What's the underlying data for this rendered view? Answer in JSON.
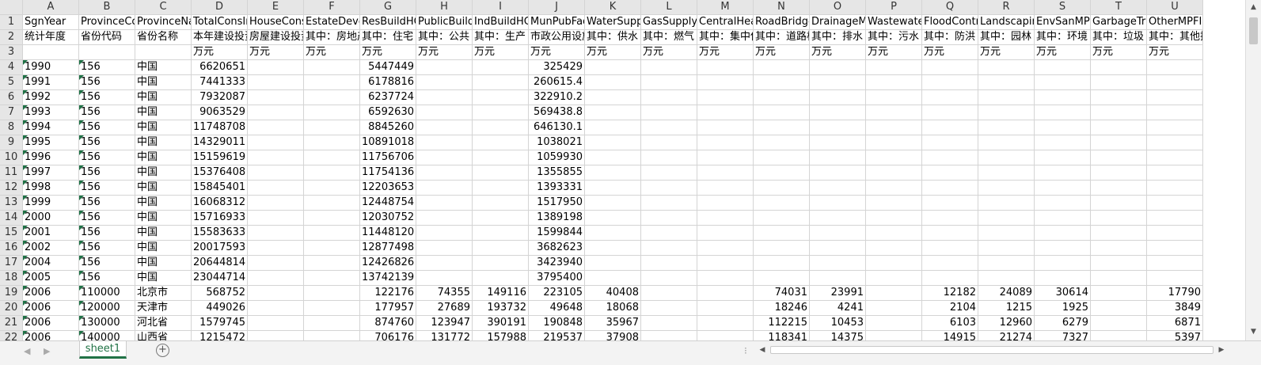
{
  "sheet": {
    "columns": [
      "A",
      "B",
      "C",
      "D",
      "E",
      "F",
      "G",
      "H",
      "I",
      "J",
      "K",
      "L",
      "M",
      "N",
      "O",
      "P",
      "Q",
      "R",
      "S",
      "T",
      "U"
    ],
    "rows": [
      [
        "SgnYear",
        "ProvinceCode",
        "ProvinceName",
        "TotalConsInv",
        "HouseConsInv",
        "EstateDevelop",
        "ResBuildHC",
        "PublicBuildHC",
        "IndBuildHC",
        "MunPubFac",
        "WaterSupply",
        "GasSupply",
        "CentralHeating",
        "RoadBridge",
        "DrainageM",
        "Wastewater",
        "FloodControl",
        "Landscaping",
        "EnvSanMP",
        "GarbageTr",
        "OtherMPFI"
      ],
      [
        "统计年度",
        "省份代码",
        "省份名称",
        "本年建设投资",
        "房屋建设投资",
        "其中：房地产",
        "其中：住宅",
        "其中：公共",
        "其中：生产",
        "市政公用设施",
        "其中：供水",
        "其中：燃气",
        "其中：集中供热",
        "其中：道路桥梁",
        "其中：排水",
        "其中：污水",
        "其中：防洪",
        "其中：园林",
        "其中：环境",
        "其中：垃圾",
        "其中：其他投入"
      ],
      [
        "",
        "",
        "",
        "万元",
        "万元",
        "万元",
        "万元",
        "万元",
        "万元",
        "万元",
        "万元",
        "万元",
        "万元",
        "万元",
        "万元",
        "万元",
        "万元",
        "万元",
        "万元",
        "万元",
        "万元"
      ],
      [
        "1990",
        "156",
        "中国",
        "6620651",
        "",
        "",
        "5447449",
        "",
        "",
        "325429",
        "",
        "",
        "",
        "",
        "",
        "",
        "",
        "",
        "",
        "",
        ""
      ],
      [
        "1991",
        "156",
        "中国",
        "7441333",
        "",
        "",
        "6178816",
        "",
        "",
        "260615.4",
        "",
        "",
        "",
        "",
        "",
        "",
        "",
        "",
        "",
        "",
        ""
      ],
      [
        "1992",
        "156",
        "中国",
        "7932087",
        "",
        "",
        "6237724",
        "",
        "",
        "322910.2",
        "",
        "",
        "",
        "",
        "",
        "",
        "",
        "",
        "",
        "",
        ""
      ],
      [
        "1993",
        "156",
        "中国",
        "9063529",
        "",
        "",
        "6592630",
        "",
        "",
        "569438.8",
        "",
        "",
        "",
        "",
        "",
        "",
        "",
        "",
        "",
        "",
        ""
      ],
      [
        "1994",
        "156",
        "中国",
        "11748708",
        "",
        "",
        "8845260",
        "",
        "",
        "646130.1",
        "",
        "",
        "",
        "",
        "",
        "",
        "",
        "",
        "",
        "",
        ""
      ],
      [
        "1995",
        "156",
        "中国",
        "14329011",
        "",
        "",
        "10891018",
        "",
        "",
        "1038021",
        "",
        "",
        "",
        "",
        "",
        "",
        "",
        "",
        "",
        "",
        ""
      ],
      [
        "1996",
        "156",
        "中国",
        "15159619",
        "",
        "",
        "11756706",
        "",
        "",
        "1059930",
        "",
        "",
        "",
        "",
        "",
        "",
        "",
        "",
        "",
        "",
        ""
      ],
      [
        "1997",
        "156",
        "中国",
        "15376408",
        "",
        "",
        "11754136",
        "",
        "",
        "1355855",
        "",
        "",
        "",
        "",
        "",
        "",
        "",
        "",
        "",
        "",
        ""
      ],
      [
        "1998",
        "156",
        "中国",
        "15845401",
        "",
        "",
        "12203653",
        "",
        "",
        "1393331",
        "",
        "",
        "",
        "",
        "",
        "",
        "",
        "",
        "",
        "",
        ""
      ],
      [
        "1999",
        "156",
        "中国",
        "16068312",
        "",
        "",
        "12448754",
        "",
        "",
        "1517950",
        "",
        "",
        "",
        "",
        "",
        "",
        "",
        "",
        "",
        "",
        ""
      ],
      [
        "2000",
        "156",
        "中国",
        "15716933",
        "",
        "",
        "12030752",
        "",
        "",
        "1389198",
        "",
        "",
        "",
        "",
        "",
        "",
        "",
        "",
        "",
        "",
        ""
      ],
      [
        "2001",
        "156",
        "中国",
        "15583633",
        "",
        "",
        "11448120",
        "",
        "",
        "1599844",
        "",
        "",
        "",
        "",
        "",
        "",
        "",
        "",
        "",
        "",
        ""
      ],
      [
        "2002",
        "156",
        "中国",
        "20017593",
        "",
        "",
        "12877498",
        "",
        "",
        "3682623",
        "",
        "",
        "",
        "",
        "",
        "",
        "",
        "",
        "",
        "",
        ""
      ],
      [
        "2004",
        "156",
        "中国",
        "20644814",
        "",
        "",
        "12426826",
        "",
        "",
        "3423940",
        "",
        "",
        "",
        "",
        "",
        "",
        "",
        "",
        "",
        "",
        ""
      ],
      [
        "2005",
        "156",
        "中国",
        "23044714",
        "",
        "",
        "13742139",
        "",
        "",
        "3795400",
        "",
        "",
        "",
        "",
        "",
        "",
        "",
        "",
        "",
        "",
        ""
      ],
      [
        "2006",
        "110000",
        "北京市",
        "568752",
        "",
        "",
        "122176",
        "74355",
        "149116",
        "223105",
        "40408",
        "",
        "",
        "74031",
        "23991",
        "",
        "12182",
        "24089",
        "30614",
        "",
        "17790"
      ],
      [
        "2006",
        "120000",
        "天津市",
        "449026",
        "",
        "",
        "177957",
        "27689",
        "193732",
        "49648",
        "18068",
        "",
        "",
        "18246",
        "4241",
        "",
        "2104",
        "1215",
        "1925",
        "",
        "3849"
      ],
      [
        "2006",
        "130000",
        "河北省",
        "1579745",
        "",
        "",
        "874760",
        "123947",
        "390191",
        "190848",
        "35967",
        "",
        "",
        "112215",
        "10453",
        "",
        "6103",
        "12960",
        "6279",
        "",
        "6871"
      ],
      [
        "2006",
        "140000",
        "山西省",
        "1215472",
        "",
        "",
        "706176",
        "131772",
        "157988",
        "219537",
        "37908",
        "",
        "",
        "118341",
        "14375",
        "",
        "14915",
        "21274",
        "7327",
        "",
        "5397"
      ]
    ]
  },
  "sheet_tab": "sheet1",
  "add_sheet_symbol": "+",
  "scroll": {
    "up": "▲",
    "down": "▼",
    "left": "◀",
    "right": "▶",
    "nav_prev": "◀",
    "nav_next": "▶",
    "sep": "⁝"
  }
}
